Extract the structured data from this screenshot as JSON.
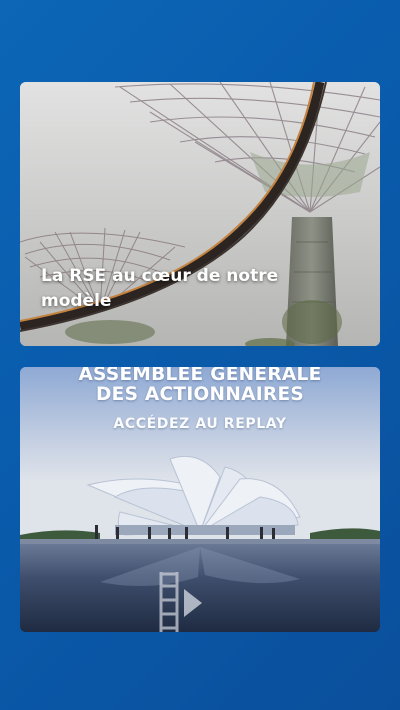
{
  "cards": [
    {
      "title": "La RSE au cœur de notre modèle",
      "image": "supertrees-skyway-photo"
    },
    {
      "line1": "ASSEMBLEE GENERALE",
      "line2": "DES ACTIONNAIRES",
      "line3": "ACCÉDEZ AU REPLAY",
      "image": "pavilion-building-photo",
      "icon": "video-play-icon"
    }
  ],
  "colors": {
    "background": "#0a5cad",
    "card_text": "#ffffff"
  }
}
